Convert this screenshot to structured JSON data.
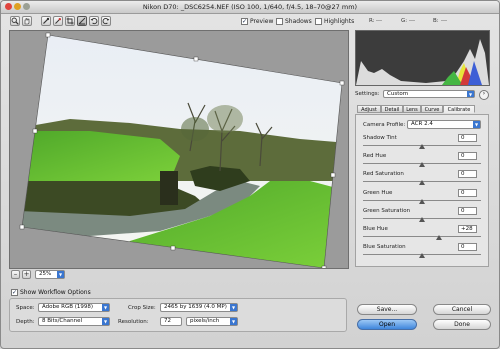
{
  "window": {
    "title": "Nikon D70:  _DSC6254.NEF  (ISO 100, 1/640, f/4.5, 18–70@27 mm)"
  },
  "toolbar": {
    "tools": [
      "zoom-icon",
      "hand-icon",
      "eyedropper-icon",
      "color-sampler-icon",
      "crop-icon",
      "straighten-icon",
      "rotate-left-icon",
      "rotate-right-icon"
    ],
    "preview_label": "Preview",
    "preview_checked": true,
    "shadows_label": "Shadows",
    "shadows_checked": false,
    "highlights_label": "Highlights",
    "highlights_checked": false,
    "r_label": "R:",
    "r_value": "---",
    "g_label": "G:",
    "g_value": "---",
    "b_label": "B:",
    "b_value": "---"
  },
  "zoom": {
    "minus": "–",
    "plus": "+",
    "value": "25%"
  },
  "settings": {
    "label": "Settings:",
    "value": "Custom"
  },
  "tabs": [
    "Adjust",
    "Detail",
    "Lens",
    "Curve",
    "Calibrate"
  ],
  "active_tab": "Calibrate",
  "calibrate": {
    "camera_profile_label": "Camera Profile:",
    "camera_profile_value": "ACR 2.4",
    "sliders": [
      {
        "label": "Shadow Tint",
        "value": "0",
        "pos": 0.5
      },
      {
        "label": "Red Hue",
        "value": "0",
        "pos": 0.5
      },
      {
        "label": "Red Saturation",
        "value": "0",
        "pos": 0.5
      },
      {
        "label": "Green Hue",
        "value": "0",
        "pos": 0.5
      },
      {
        "label": "Green Saturation",
        "value": "0",
        "pos": 0.5
      },
      {
        "label": "Blue Hue",
        "value": "+28",
        "pos": 0.64
      },
      {
        "label": "Blue Saturation",
        "value": "0",
        "pos": 0.5
      }
    ]
  },
  "workflow": {
    "show_label": "Show Workflow Options",
    "show_checked": true,
    "space_label": "Space:",
    "space_value": "Adobe RGB (1998)",
    "depth_label": "Depth:",
    "depth_value": "8 Bits/Channel",
    "crop_label": "Crop Size:",
    "crop_value": "2465 by 1639 (4.0 MP)",
    "resolution_label": "Resolution:",
    "resolution_value": "72",
    "resolution_unit": "pixels/inch"
  },
  "buttons": {
    "save": "Save...",
    "open": "Open",
    "cancel": "Cancel",
    "done": "Done"
  }
}
